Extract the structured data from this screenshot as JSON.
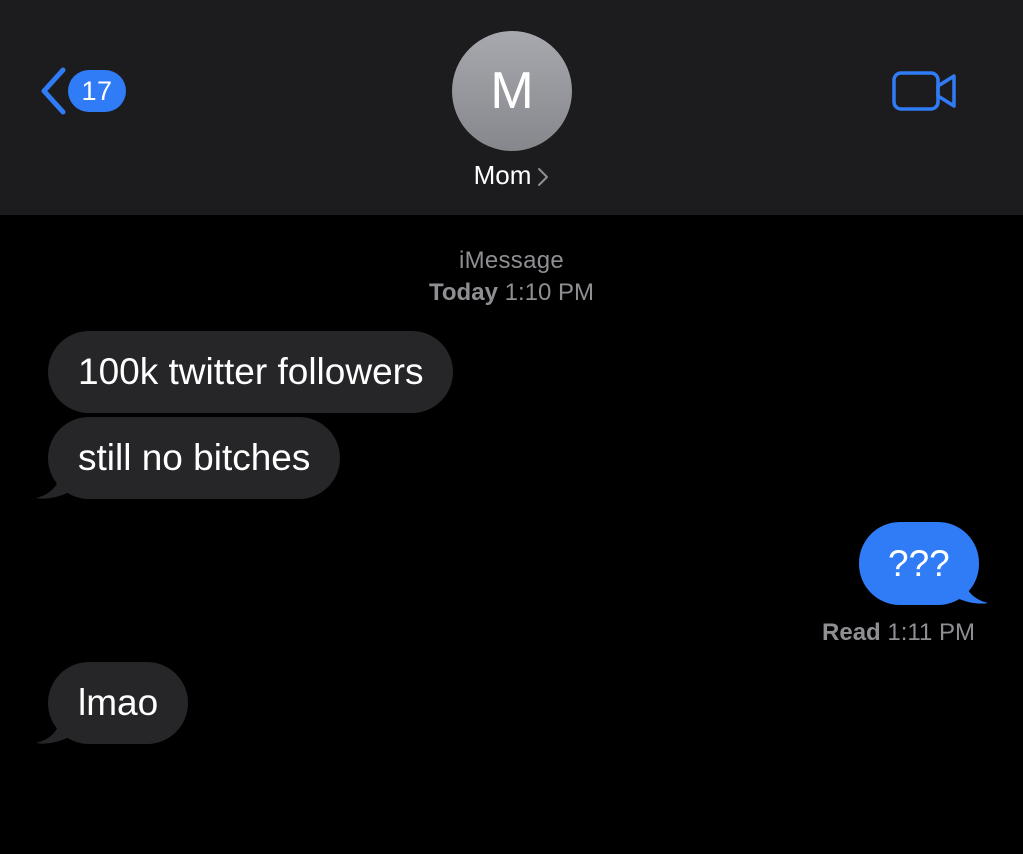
{
  "header": {
    "back_badge_count": "17",
    "avatar_initial": "M",
    "contact_name": "Mom"
  },
  "conversation": {
    "service": "iMessage",
    "timestamp_day": "Today",
    "timestamp_time": "1:10 PM",
    "messages": [
      {
        "direction": "incoming",
        "text": "100k twitter followers"
      },
      {
        "direction": "incoming",
        "text": "still no bitches"
      },
      {
        "direction": "outgoing",
        "text": "???"
      },
      {
        "direction": "incoming",
        "text": "lmao"
      }
    ],
    "read_receipt": {
      "label": "Read",
      "time": "1:11 PM"
    }
  },
  "colors": {
    "accent": "#2f7cf6",
    "header_bg": "#1c1c1e",
    "incoming_bubble": "#262629",
    "secondary_text": "#8e8e93"
  },
  "icons": {
    "back": "chevron-left-icon",
    "video": "video-camera-icon",
    "contact_details": "chevron-right-icon"
  }
}
